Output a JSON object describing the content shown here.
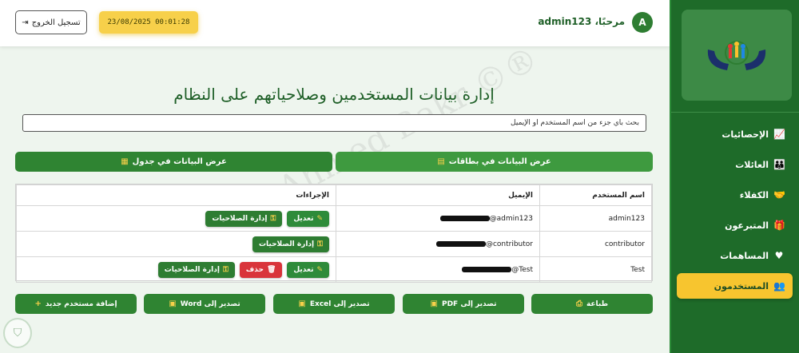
{
  "header": {
    "avatar_letter": "A",
    "welcome": "مرحبًا، admin123",
    "clock": "23/08/2025 00:01:28",
    "logout_label": "تسجيل الخروج"
  },
  "sidebar": {
    "items": [
      {
        "label": "الإحصائيات",
        "icon": "chart-icon"
      },
      {
        "label": "العائلات",
        "icon": "users-icon"
      },
      {
        "label": "الكفلاء",
        "icon": "handshake-icon"
      },
      {
        "label": "المتبرعون",
        "icon": "gift-icon"
      },
      {
        "label": "المساهمات",
        "icon": "donation-icon"
      },
      {
        "label": "المستخدمون",
        "icon": "user-group-icon",
        "active": true
      }
    ]
  },
  "main": {
    "title": "إدارة بيانات المستخدمين وصلاحياتهم على النظام",
    "search_placeholder": "بحث بأي جزء من اسم المستخدم أو الإيميل",
    "view_cards_label": "عرض البيانات في بطاقات",
    "view_table_label": "عرض البيانات في جدول"
  },
  "table": {
    "headers": {
      "username": "اسم المستخدم",
      "email": "الإيميل",
      "actions": "الإجراءات"
    },
    "rows": [
      {
        "username": "admin123",
        "email": "admin123@"
      },
      {
        "username": "contributor",
        "email": "contributor@"
      },
      {
        "username": "Test",
        "email": "Test@"
      }
    ],
    "edit_label": "تعديل",
    "perm_label": "إدارة الصلاحيات",
    "delete_label": "حذف"
  },
  "bottom": {
    "add_user": "إضافة مستخدم جديد",
    "export_word": "تصدير إلى Word",
    "export_excel": "تصدير إلى Excel",
    "export_pdf": "تصدير إلى PDF",
    "print": "طباعة"
  },
  "watermark": "Ahmed Bakr ©®",
  "colors": {
    "primary": "#2f8432",
    "sidebar": "#1e6b29",
    "accent": "#f7c52f",
    "danger": "#d9343b"
  }
}
